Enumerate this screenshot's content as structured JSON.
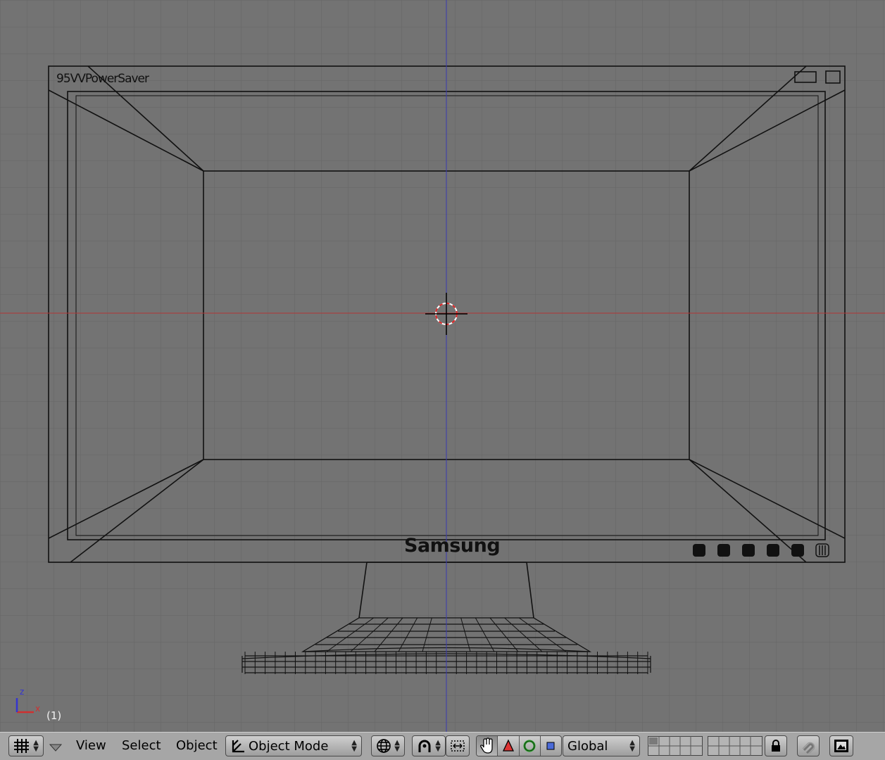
{
  "viewport": {
    "frame_counter": "(1)",
    "axis_labels": {
      "z": "z",
      "x": "x"
    },
    "model": {
      "top_label": "95VVPowerSaver",
      "brand": "Samsung"
    },
    "colors": {
      "background": "#737373",
      "grid": "#666666",
      "x_axis": "#b03535",
      "z_axis": "#3a3ab0",
      "wire": "#111111"
    }
  },
  "header": {
    "editor_type_icon": "grid-icon",
    "menus": [
      "View",
      "Select",
      "Object"
    ],
    "mode": {
      "label": "Object Mode",
      "icon": "object-mode-icon"
    },
    "draw_type_icon": "wireframe-sphere-icon",
    "pivot_icon": "pivot-icon",
    "manipulator_icons": [
      "hand-icon",
      "translate-icon",
      "rotate-icon",
      "scale-icon"
    ],
    "orientation": "Global",
    "lock_icon": "lock-icon",
    "snap_icon": "magnet-icon",
    "render_icon": "render-icon"
  }
}
